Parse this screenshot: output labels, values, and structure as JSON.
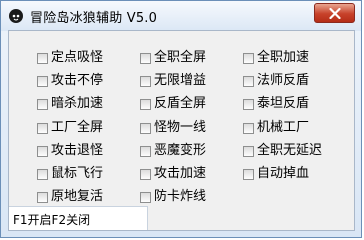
{
  "window": {
    "title": "冒险岛冰狼辅助 V5.0"
  },
  "options": {
    "col1": [
      "定点吸怪",
      "攻击不停",
      "暗杀加速",
      "工厂全屏",
      "攻击退怪",
      "鼠标飞行",
      "原地复活"
    ],
    "col2": [
      "全职全屏",
      "无限增益",
      "反盾全屏",
      "怪物一线",
      "恶魔变形",
      "攻击加速",
      "防卡炸线"
    ],
    "col3": [
      "全职加速",
      "法师反盾",
      "泰坦反盾",
      "机械工厂",
      "全职无延迟",
      "自动掉血"
    ]
  },
  "status": {
    "text": "F1开启F2关闭"
  }
}
